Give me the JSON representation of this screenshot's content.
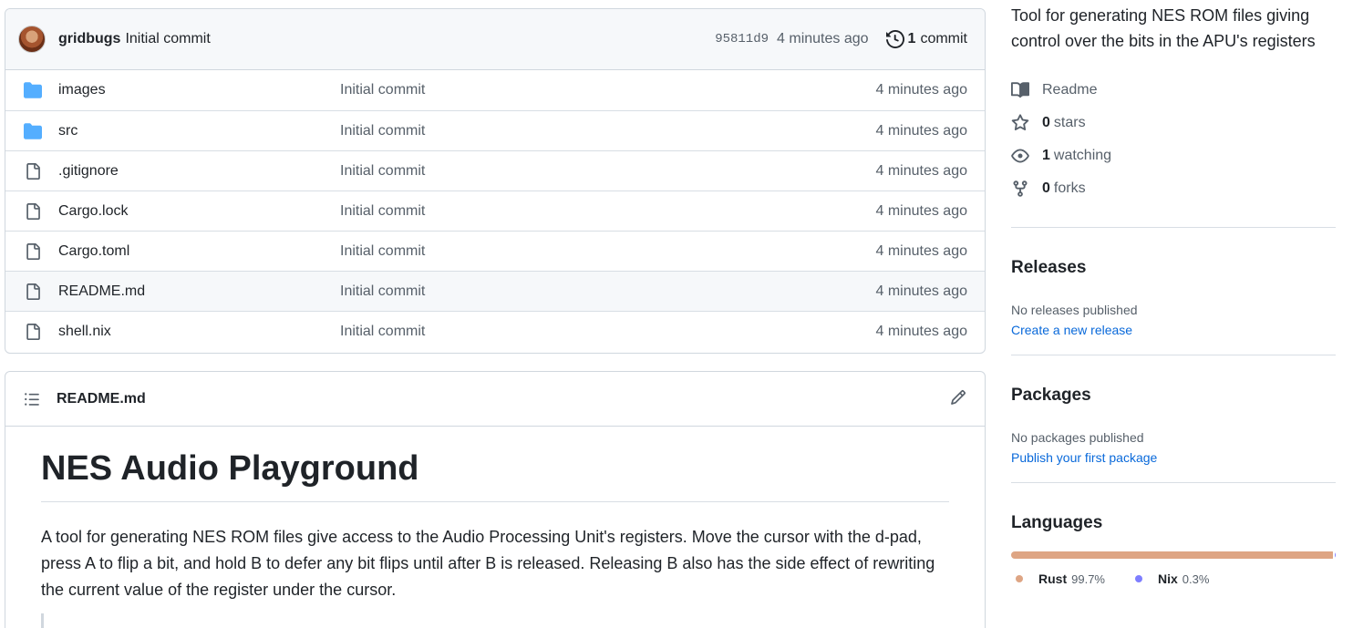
{
  "commit": {
    "author": "gridbugs",
    "message": "Initial commit",
    "sha": "95811d9",
    "age": "4 minutes ago",
    "count": "1",
    "count_label": "commit"
  },
  "files": [
    {
      "name": "images",
      "type": "folder",
      "message": "Initial commit",
      "age": "4 minutes ago"
    },
    {
      "name": "src",
      "type": "folder",
      "message": "Initial commit",
      "age": "4 minutes ago"
    },
    {
      "name": ".gitignore",
      "type": "file",
      "message": "Initial commit",
      "age": "4 minutes ago"
    },
    {
      "name": "Cargo.lock",
      "type": "file",
      "message": "Initial commit",
      "age": "4 minutes ago"
    },
    {
      "name": "Cargo.toml",
      "type": "file",
      "message": "Initial commit",
      "age": "4 minutes ago"
    },
    {
      "name": "README.md",
      "type": "file",
      "message": "Initial commit",
      "age": "4 minutes ago"
    },
    {
      "name": "shell.nix",
      "type": "file",
      "message": "Initial commit",
      "age": "4 minutes ago"
    }
  ],
  "readme": {
    "filename": "README.md",
    "heading": "NES Audio Playground",
    "paragraph": "A tool for generating NES ROM files give access to the Audio Processing Unit's registers. Move the cursor with the d-pad, press A to flip a bit, and hold B to defer any bit flips until after B is released. Releasing B also has the side effect of rewriting the current value of the register under the cursor."
  },
  "sidebar": {
    "about": "Tool for generating NES ROM files giving control over the bits in the APU's registers",
    "readme_label": "Readme",
    "stars_count": "0",
    "stars_label": "stars",
    "watching_count": "1",
    "watching_label": "watching",
    "forks_count": "0",
    "forks_label": "forks",
    "releases": {
      "title": "Releases",
      "status": "No releases published",
      "link": "Create a new release"
    },
    "packages": {
      "title": "Packages",
      "status": "No packages published",
      "link": "Publish your first package"
    },
    "languages": {
      "title": "Languages",
      "items": [
        {
          "name": "Rust",
          "percent": "99.7%",
          "color": "#dea584",
          "share": 99.7
        },
        {
          "name": "Nix",
          "percent": "0.3%",
          "color": "#7e7eff",
          "share": 0.3
        }
      ]
    }
  },
  "colors": {
    "folder": "#54aeff",
    "link": "#0969da",
    "muted": "#57606a"
  }
}
